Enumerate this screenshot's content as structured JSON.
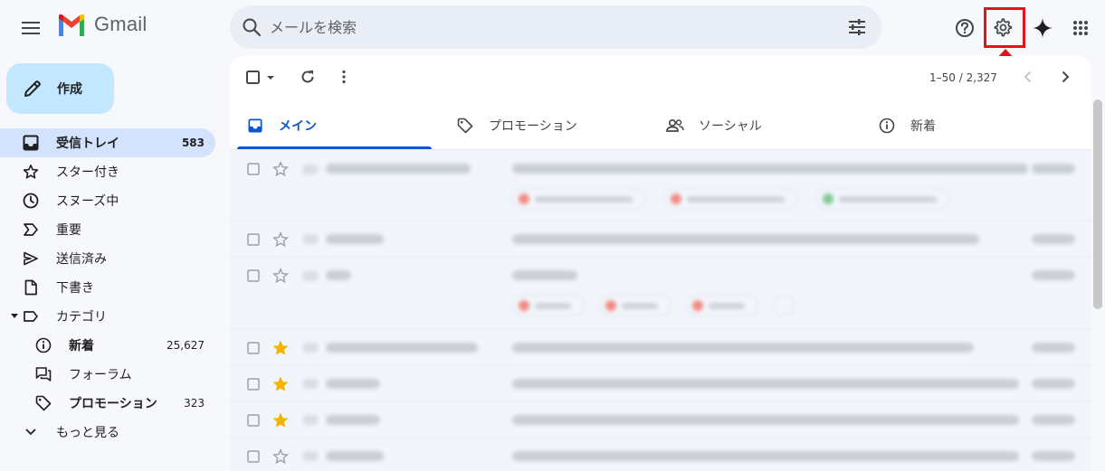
{
  "app": {
    "name": "Gmail"
  },
  "search": {
    "placeholder": "メールを検索"
  },
  "compose": {
    "label": "作成"
  },
  "sidebar": {
    "items": [
      {
        "label": "受信トレイ",
        "count": "583",
        "icon": "inbox-icon",
        "active": true
      },
      {
        "label": "スター付き",
        "icon": "star-icon"
      },
      {
        "label": "スヌーズ中",
        "icon": "clock-icon"
      },
      {
        "label": "重要",
        "icon": "important-icon"
      },
      {
        "label": "送信済み",
        "icon": "send-icon"
      },
      {
        "label": "下書き",
        "icon": "draft-icon"
      },
      {
        "label": "カテゴリ",
        "icon": "label-icon"
      }
    ],
    "categories": [
      {
        "label": "新着",
        "count": "25,627",
        "icon": "info-icon"
      },
      {
        "label": "フォーラム",
        "icon": "forum-icon"
      },
      {
        "label": "プロモーション",
        "count": "323",
        "icon": "tag-icon"
      }
    ],
    "more": {
      "label": "もっと見る"
    }
  },
  "toolbar": {
    "pagination": "1–50 / 2,327"
  },
  "tabs": [
    {
      "label": "メイン",
      "icon": "inbox-icon"
    },
    {
      "label": "プロモーション",
      "icon": "tag-icon"
    },
    {
      "label": "ソーシャル",
      "icon": "people-icon"
    },
    {
      "label": "新着",
      "icon": "info-icon"
    }
  ],
  "colors": {
    "accent": "#0b57d0",
    "compose_bg": "#c2e7ff",
    "active_nav_bg": "#d3e3fd",
    "highlight": "#e8111a",
    "star": "#f4b400"
  }
}
